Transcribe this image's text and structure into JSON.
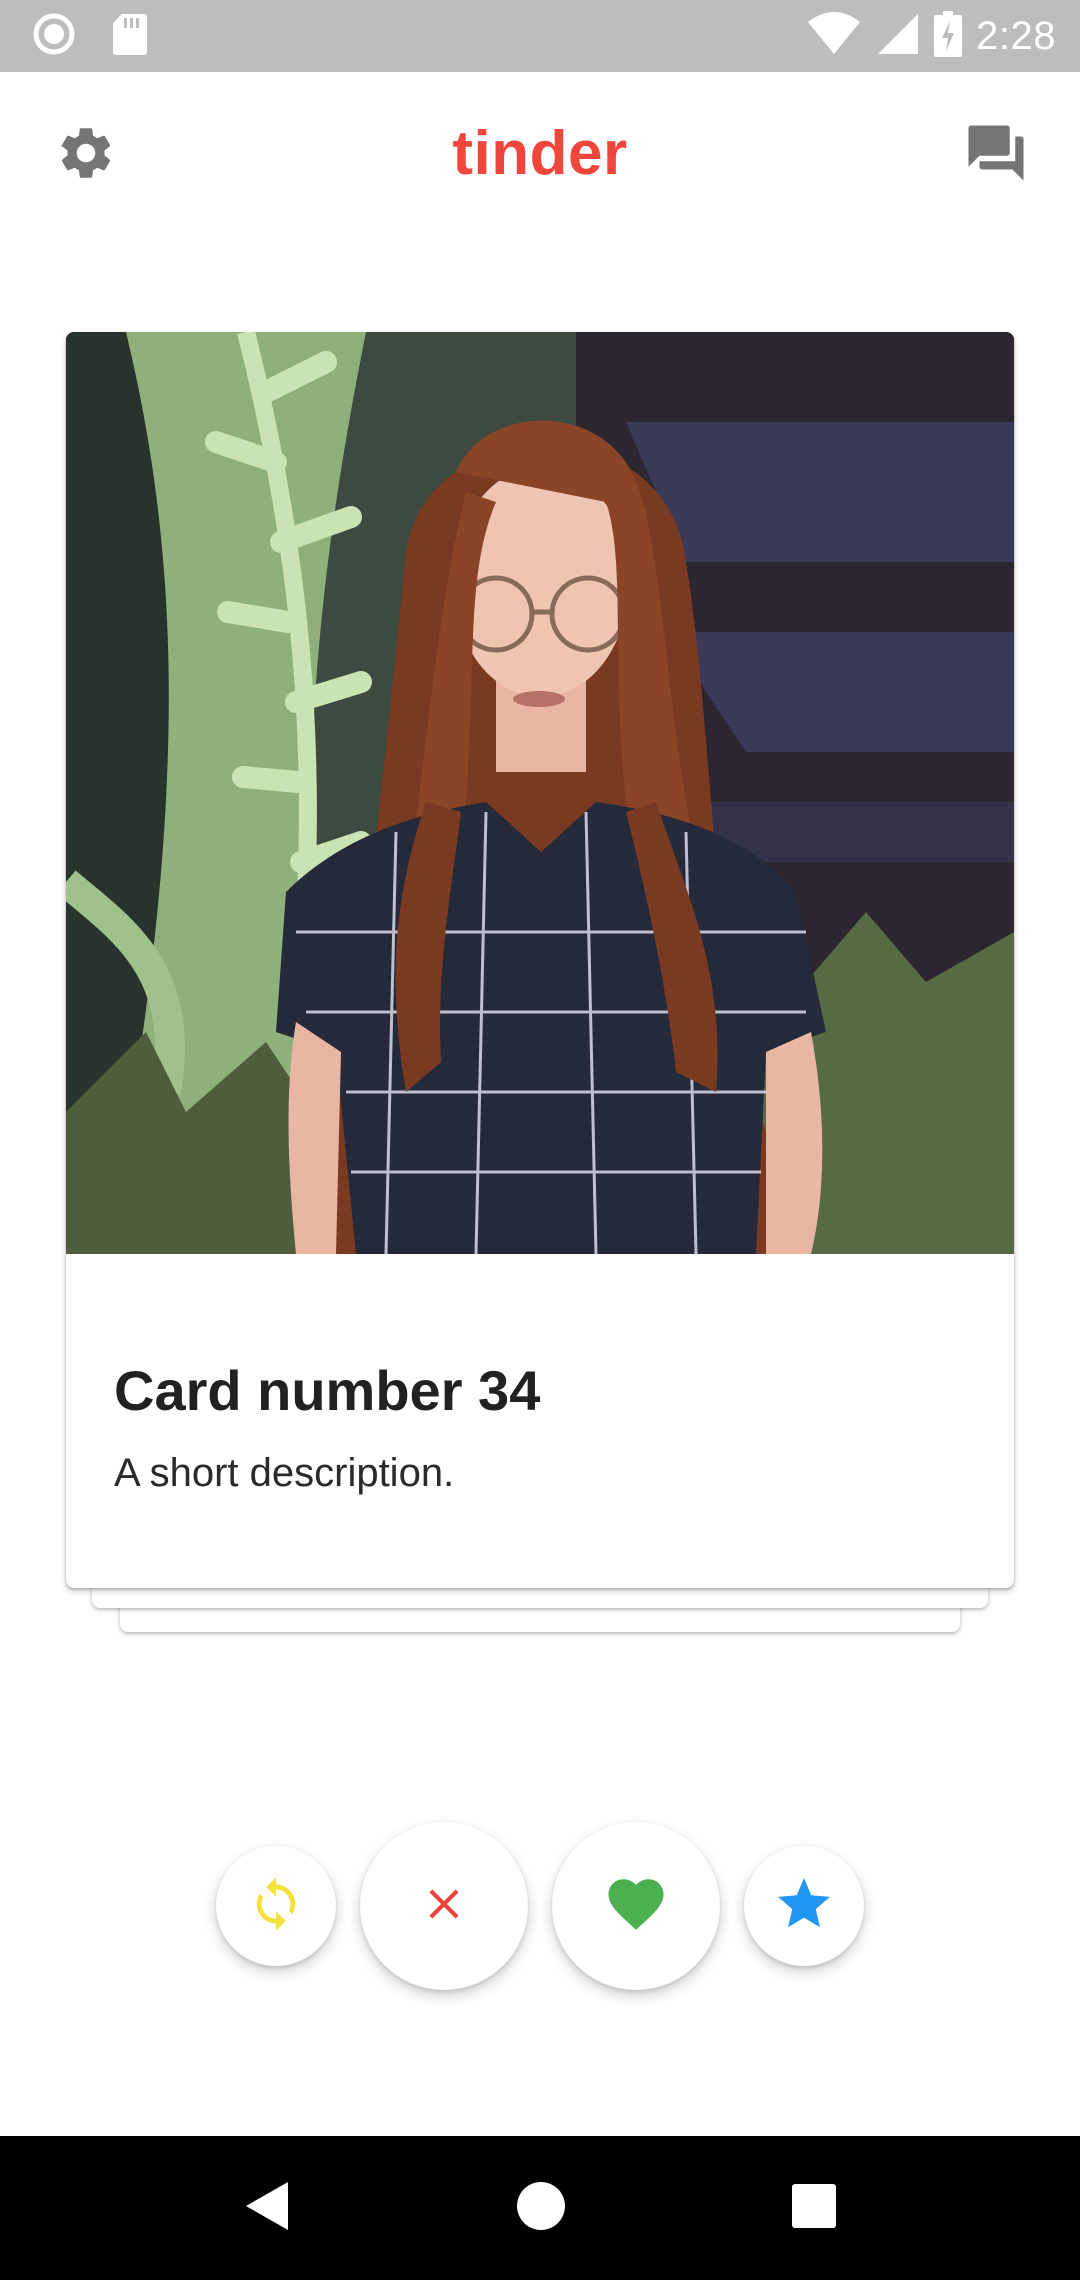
{
  "status_bar": {
    "time": "2:28",
    "icons": [
      "record-icon",
      "sd-card-icon",
      "wifi-icon",
      "signal-icon",
      "battery-charging-icon"
    ]
  },
  "app_bar": {
    "title": "tinder",
    "left_icon": "settings-gear-icon",
    "right_icon": "chat-forum-icon",
    "accent_color": "#f0463c"
  },
  "card": {
    "title": "Card number 34",
    "description": "A short description.",
    "photo_subject": "profile-photo"
  },
  "actions": [
    {
      "name": "rewind-button",
      "icon": "refresh-icon",
      "color": "#f5e13c"
    },
    {
      "name": "nope-button",
      "icon": "close-x-icon",
      "color": "#e8453c"
    },
    {
      "name": "like-button",
      "icon": "heart-icon",
      "color": "#4caf50"
    },
    {
      "name": "super-like-button",
      "icon": "star-icon",
      "color": "#2196f3"
    }
  ],
  "nav_bar": {
    "items": [
      "back-icon",
      "home-icon",
      "recents-icon"
    ]
  }
}
